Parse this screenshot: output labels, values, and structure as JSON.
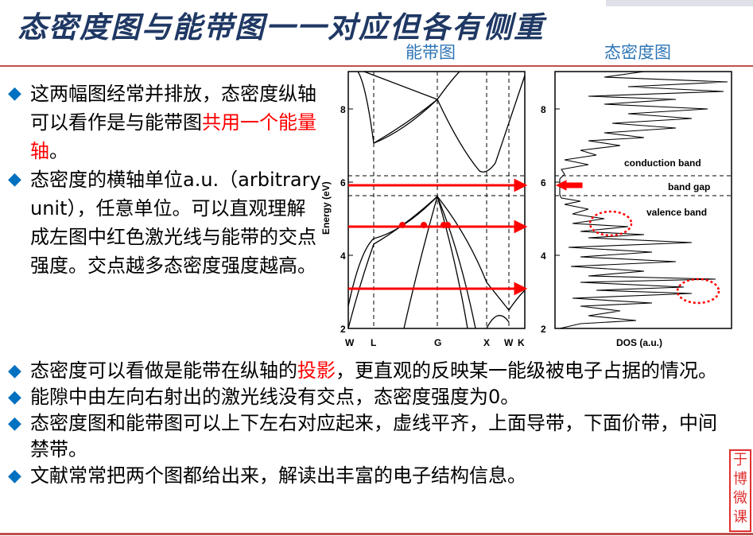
{
  "title": "态密度图与能带图一一对应但各有侧重",
  "labels": {
    "band": "能带图",
    "dos": "态密度图"
  },
  "bullets_left": [
    {
      "parts": [
        "这两幅图经常并排放，态密度纵轴可以看作是与能带图",
        "共用一个能量轴",
        "。"
      ]
    },
    {
      "parts": [
        "态密度的横轴单位a.u.（arbitrary unit），任意单位。可以直观理解成左图中红色激光线与能带的交点强度。交点越多态密度强度越高。"
      ]
    }
  ],
  "bullets_bottom": [
    {
      "parts": [
        "态密度可以看做是能带在纵轴的",
        "投影",
        "，更直观的反映某一能级被电子占据的情况。"
      ]
    },
    {
      "parts": [
        "能隙中由左向右射出的激光线没有交点，态密度强度为0。"
      ]
    },
    {
      "parts": [
        "态密度图和能带图可以上下左右对应起来，虚线平齐，上面导带，下面价带，中间禁带。"
      ]
    },
    {
      "parts": [
        "文献常常把两个图都给出来，解读出丰富的电子结构信息。"
      ]
    }
  ],
  "band_plot": {
    "ylabel": "Energy (eV)",
    "y_ticks": [
      "2",
      "4",
      "6",
      "8"
    ],
    "x_ticks": [
      "W",
      "L",
      "G",
      "X",
      "W",
      "K"
    ]
  },
  "dos_plot": {
    "xlabel": "DOS (a.u.)",
    "y_ticks": [
      "2",
      "4",
      "6",
      "8"
    ],
    "annotations": {
      "conduction": "conduction band",
      "gap": "band gap",
      "valence": "valence band"
    }
  },
  "stamp": [
    "于",
    "博",
    "微",
    "课"
  ],
  "colors": {
    "title": "#1f3864",
    "accent": "#ff0000",
    "bullet": "#0070c0",
    "label": "#2e75b6"
  }
}
